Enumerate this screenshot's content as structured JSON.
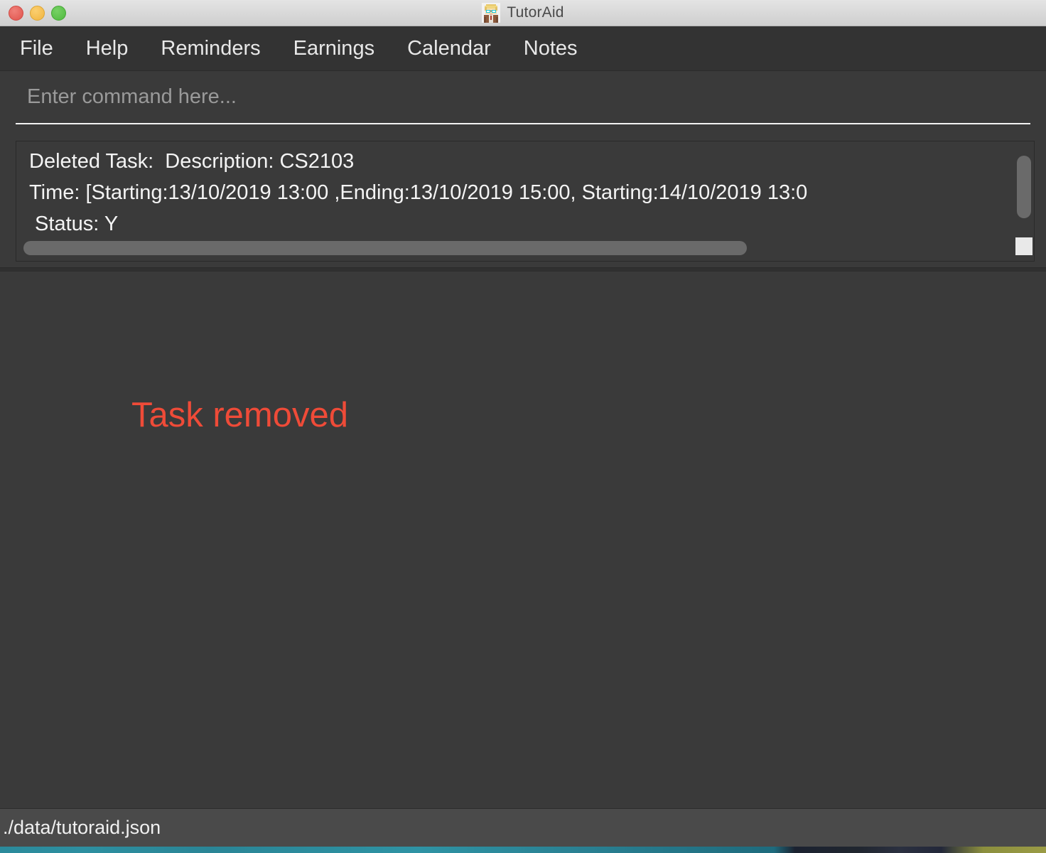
{
  "window": {
    "title": "TutorAid",
    "icon": "tutor-avatar-icon",
    "controls": {
      "close_label": "close",
      "minimize_label": "minimize",
      "maximize_label": "maximize",
      "close_color": "#e0534c",
      "minimize_color": "#f0b43f",
      "maximize_color": "#4fb93e"
    }
  },
  "menubar": {
    "items": [
      {
        "label": "File"
      },
      {
        "label": "Help"
      },
      {
        "label": "Reminders"
      },
      {
        "label": "Earnings"
      },
      {
        "label": "Calendar"
      },
      {
        "label": "Notes"
      }
    ]
  },
  "command": {
    "placeholder": "Enter command here...",
    "value": ""
  },
  "result": {
    "lines": [
      "Deleted Task:  Description: CS2103",
      "Time: [Starting:13/10/2019 13:00 ,Ending:13/10/2019 15:00, Starting:14/10/2019 13:0",
      " Status: Y"
    ],
    "text": "Deleted Task:  Description: CS2103\nTime: [Starting:13/10/2019 13:00 ,Ending:13/10/2019 15:00, Starting:14/10/2019 13:0\n Status: Y"
  },
  "main": {
    "status_message": "Task removed",
    "status_message_color": "#ef4b38"
  },
  "statusbar": {
    "path": "./data/tutoraid.json"
  },
  "theme": {
    "window_background": "#3a3a3a",
    "menubar_background": "#333333",
    "statusbar_background": "#4a4a4a",
    "text_color": "#f4f4f4"
  }
}
